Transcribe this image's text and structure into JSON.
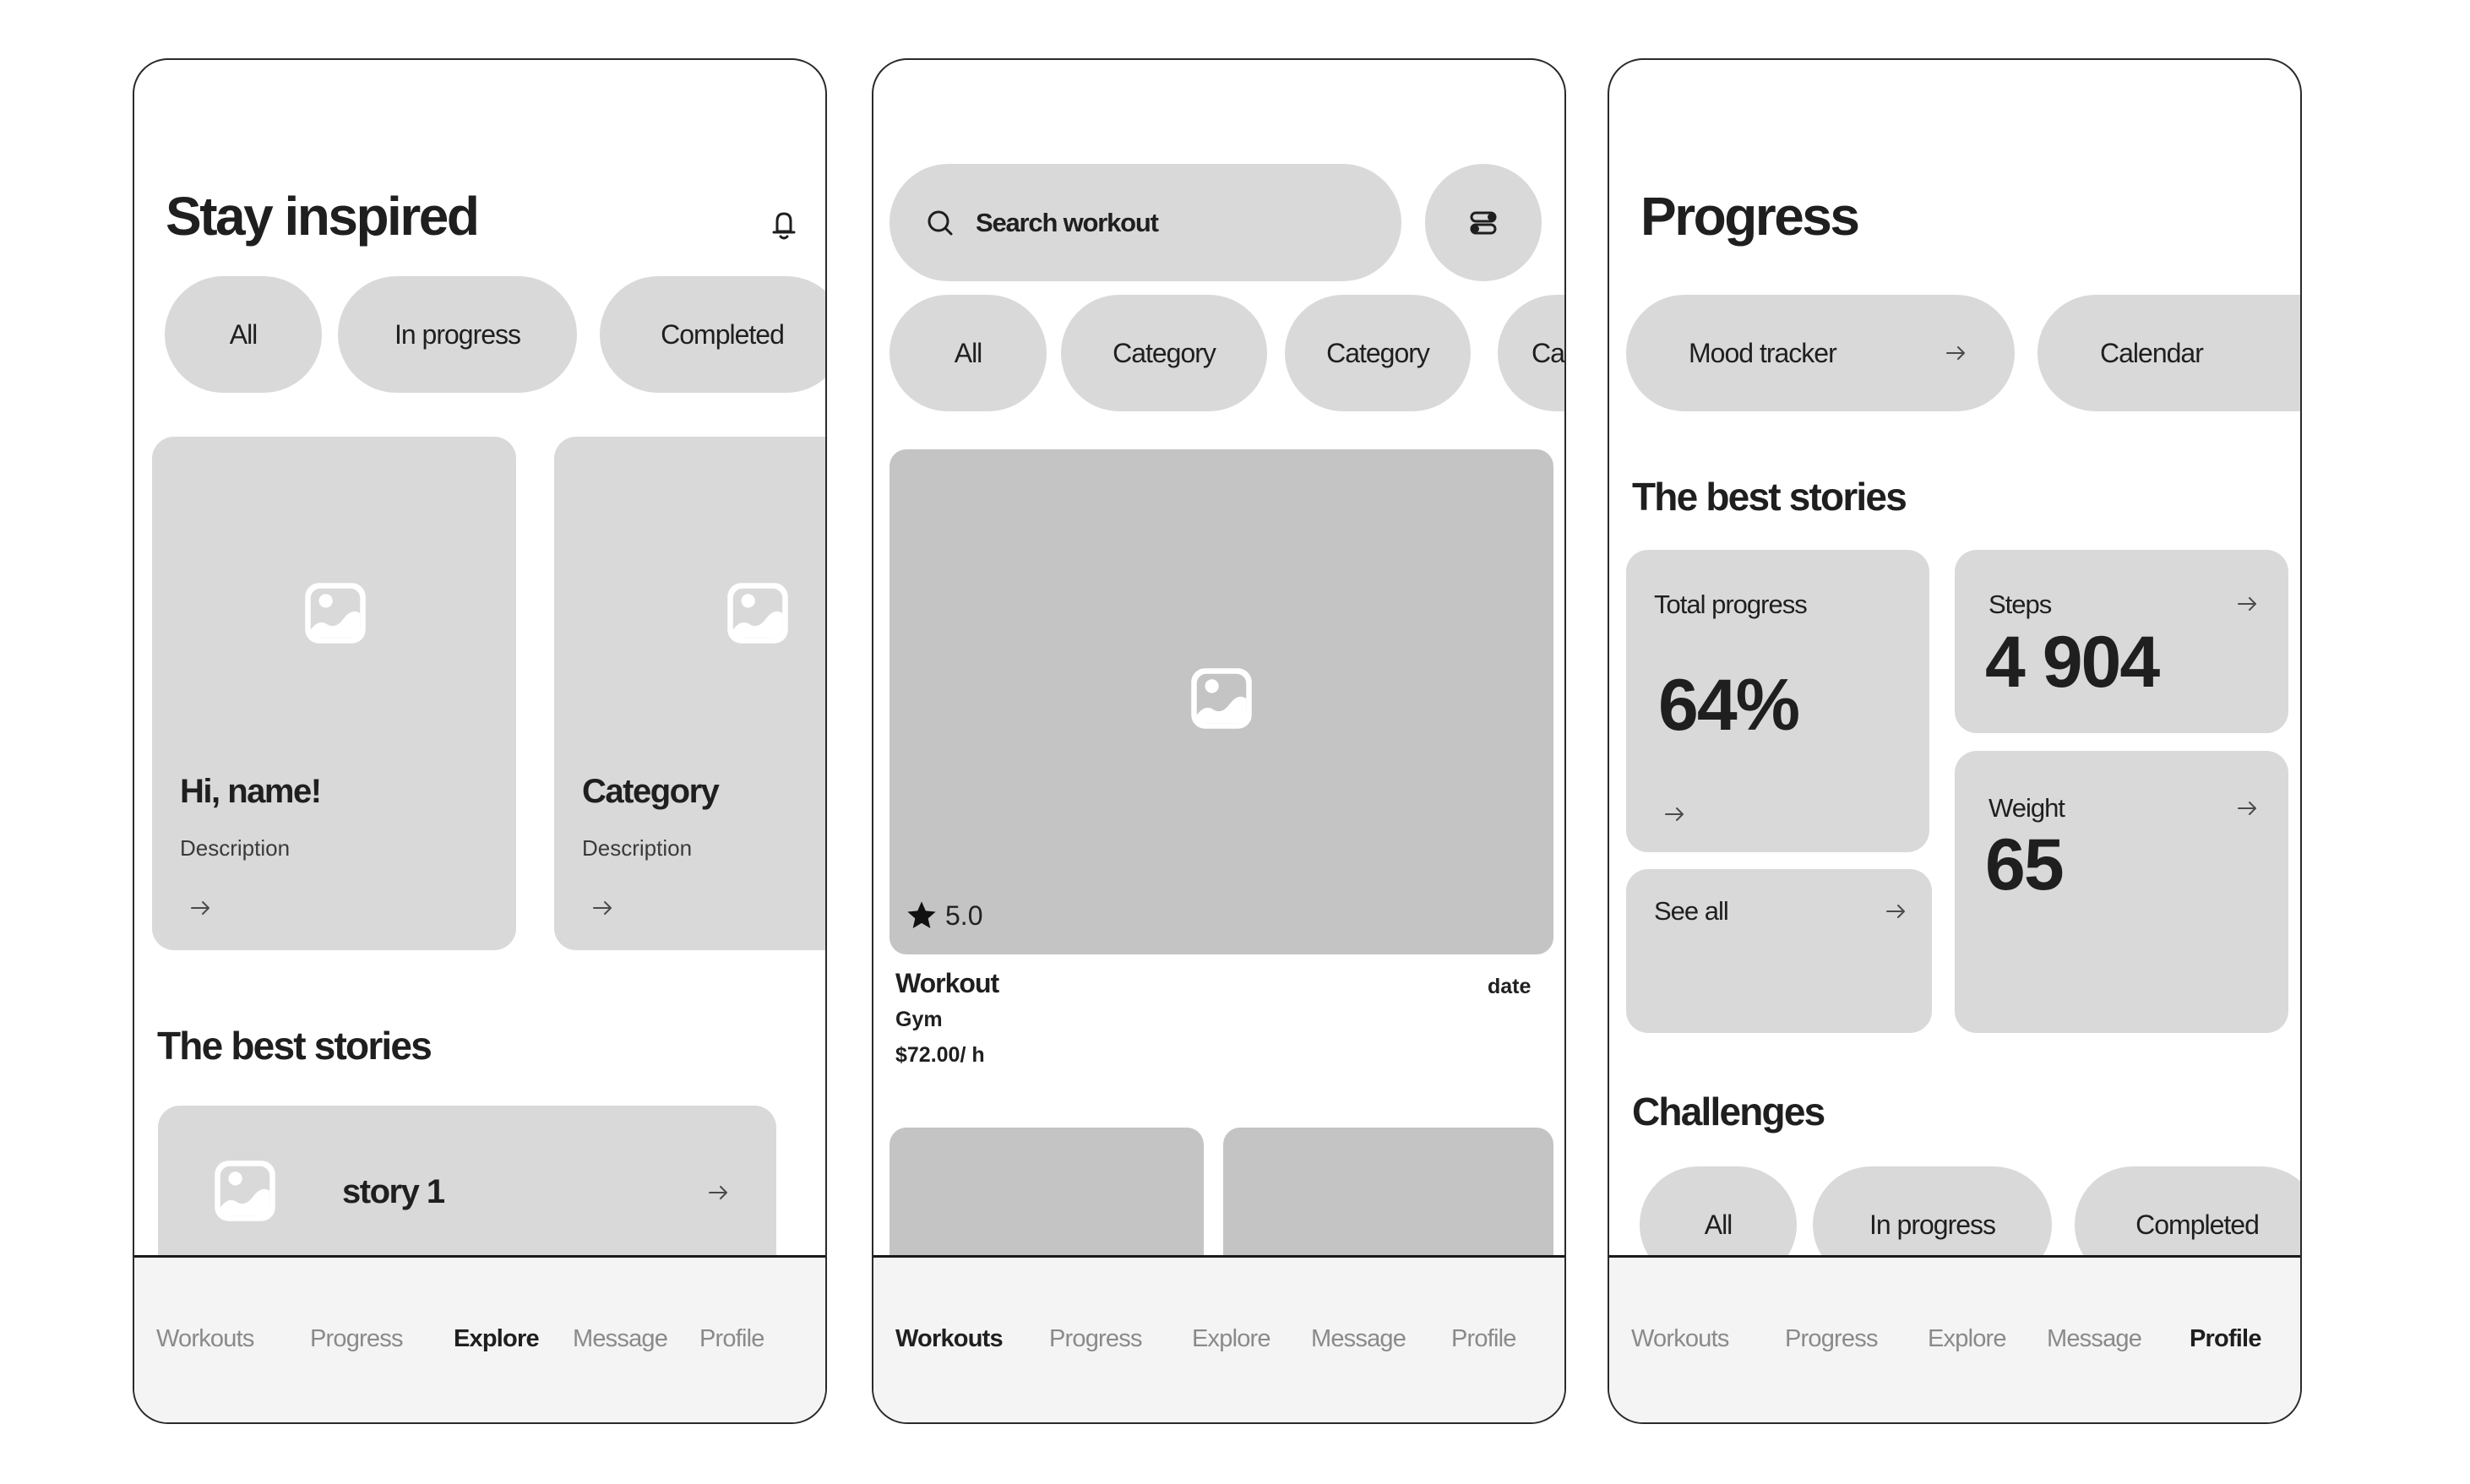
{
  "screens": [
    {
      "title": "Stay inspired",
      "filters": [
        "All",
        "In progress",
        "Completed"
      ],
      "cards": [
        {
          "title": "Hi, name!",
          "description": "Description"
        },
        {
          "title": "Category",
          "description": "Description"
        }
      ],
      "section_title": "The best stories",
      "stories": [
        {
          "label": "story 1"
        }
      ],
      "active_nav": "Explore"
    },
    {
      "search": {
        "placeholder": "Search workout"
      },
      "filters": [
        "All",
        "Category",
        "Category",
        "Category"
      ],
      "workout": {
        "rating": "5.0",
        "title": "Workout",
        "date": "date",
        "location": "Gym",
        "price": "$72.00/ h"
      },
      "active_nav": "Workouts"
    },
    {
      "title": "Progress",
      "quick_links": [
        {
          "label": "Mood tracker"
        },
        {
          "label": "Calendar"
        }
      ],
      "section_title": "The best stories",
      "stats": {
        "total_progress": {
          "label": "Total progress",
          "value": "64%",
          "fraction": 0.64
        },
        "steps": {
          "label": "Steps",
          "value": "4 904"
        },
        "weight": {
          "label": "Weight",
          "value": "65"
        },
        "see_all": {
          "label": "See all"
        }
      },
      "challenges_title": "Challenges",
      "challenge_filters": [
        "All",
        "In progress",
        "Completed"
      ],
      "active_nav": "Profile"
    }
  ],
  "nav": [
    "Workouts",
    "Progress",
    "Explore",
    "Message",
    "Profile"
  ],
  "colors": {
    "chip_bg": "#d9d9d9",
    "image_bg": "#c4c4c4",
    "nav_bg": "#f4f4f4",
    "text_primary": "#1f1f1f",
    "text_muted": "#8a8a8a"
  }
}
